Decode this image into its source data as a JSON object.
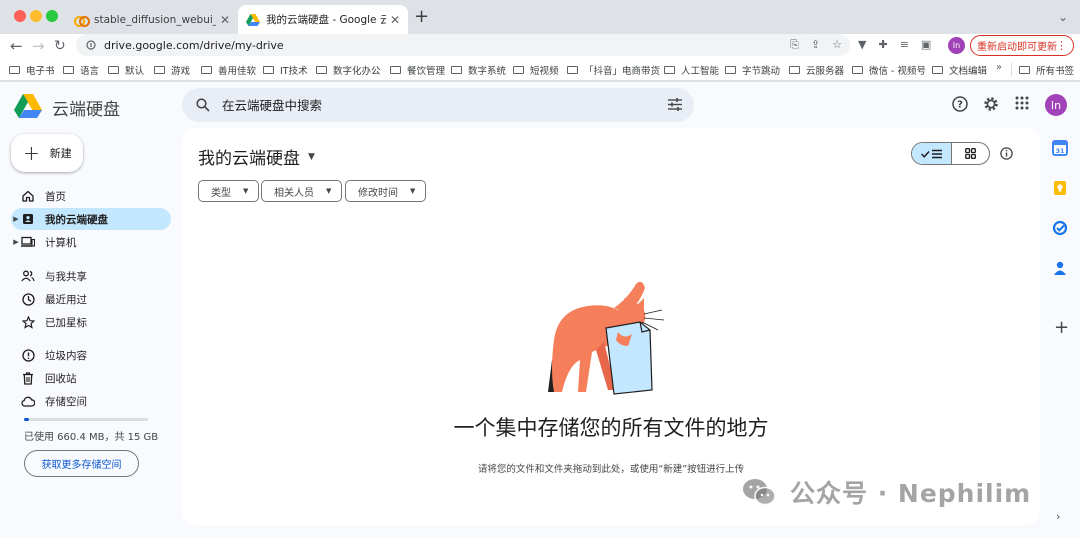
{
  "browser": {
    "tabs": [
      {
        "title": "stable_diffusion_webui_colab"
      },
      {
        "title": "我的云端硬盘 - Google 云端硬盘"
      }
    ],
    "url": "drive.google.com/drive/my-drive",
    "profile_initial": "In",
    "update_label": "重新启动即可更新",
    "bookmarks": [
      "电子书",
      "语言",
      "默认",
      "游戏",
      "善用佳软",
      "IT技术",
      "数字化办公",
      "餐饮管理",
      "数字系统",
      "短视频",
      "「抖音」电商带货",
      "人工智能",
      "字节跳动",
      "云服务器",
      "微信 - 视频号",
      "文档编辑"
    ],
    "bookmarks_more": "»",
    "all_bookmarks": "所有书签"
  },
  "drive": {
    "logo_text": "云端硬盘",
    "search_placeholder": "在云端硬盘中搜索",
    "avatar_initial": "In",
    "new_label": "新建",
    "nav": [
      {
        "label": "首页"
      },
      {
        "label": "我的云端硬盘"
      },
      {
        "label": "计算机"
      },
      {
        "label": "与我共享"
      },
      {
        "label": "最近用过"
      },
      {
        "label": "已加星标"
      },
      {
        "label": "垃圾内容"
      },
      {
        "label": "回收站"
      },
      {
        "label": "存储空间"
      }
    ],
    "storage": {
      "used_fraction": 0.04,
      "text": "已使用 660.4 MB，共 15 GB",
      "button": "获取更多存储空间"
    },
    "main": {
      "title": "我的云端硬盘",
      "filters": [
        "类型",
        "相关人员",
        "修改时间"
      ],
      "empty_title": "一个集中存储您的所有文件的地方",
      "empty_subtitle": "请将您的文件和文件夹拖动到此处，或使用“新建”按钮进行上传"
    }
  },
  "watermark": {
    "text": "公众号 · Nephilim"
  },
  "colors": {
    "accent_blue": "#0b57d0",
    "selected_bg": "#c2e7ff",
    "update_red": "#d93025",
    "avatar_purple": "#a142b8",
    "cat_orange": "#f47f5a"
  }
}
